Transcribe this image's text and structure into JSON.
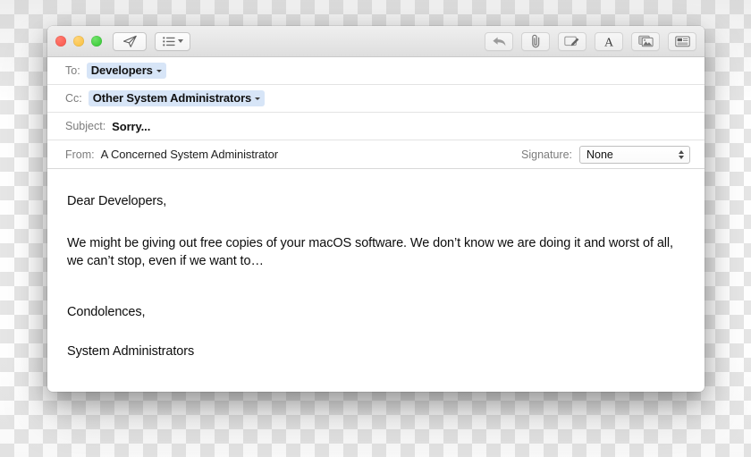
{
  "window": {
    "traffic_lights": [
      {
        "name": "close",
        "color": "#f9534a"
      },
      {
        "name": "minimize",
        "color": "#f7bd37"
      },
      {
        "name": "zoom",
        "color": "#2cc42c"
      }
    ]
  },
  "toolbar": {
    "send_icon": "paper-plane-icon",
    "send_label": "Send",
    "header_fields_icon": "list-icon",
    "header_fields_label": "Header Fields",
    "right_buttons": [
      {
        "name": "reply-arrow-icon",
        "label": "Reply"
      },
      {
        "name": "paperclip-icon",
        "label": "Attach"
      },
      {
        "name": "markup-icon",
        "label": "Markup"
      },
      {
        "name": "format-text-icon",
        "label": "A"
      },
      {
        "name": "photo-browser-icon",
        "label": "Photo Browser"
      },
      {
        "name": "stationery-icon",
        "label": "Stationery"
      }
    ]
  },
  "headers": {
    "to_label": "To:",
    "to_token": "Developers",
    "cc_label": "Cc:",
    "cc_token": "Other System Administrators",
    "subject_label": "Subject:",
    "subject_value": "Sorry...",
    "from_label": "From:",
    "from_value": "A Concerned System Administrator",
    "signature_label": "Signature:",
    "signature_value": "None"
  },
  "body": {
    "greeting": "Dear Developers,",
    "paragraph": "We might be giving out free copies of your macOS software. We don’t know we are doing it and worst of all, we can’t stop, even if we want to…",
    "closing": "Condolences,",
    "signoff": "System Administrators"
  },
  "colors": {
    "token_background": "#d7e5f7",
    "toolbar_background": "#e6e6e6",
    "window_background": "#ffffff",
    "label_text": "#7c7c7c"
  }
}
